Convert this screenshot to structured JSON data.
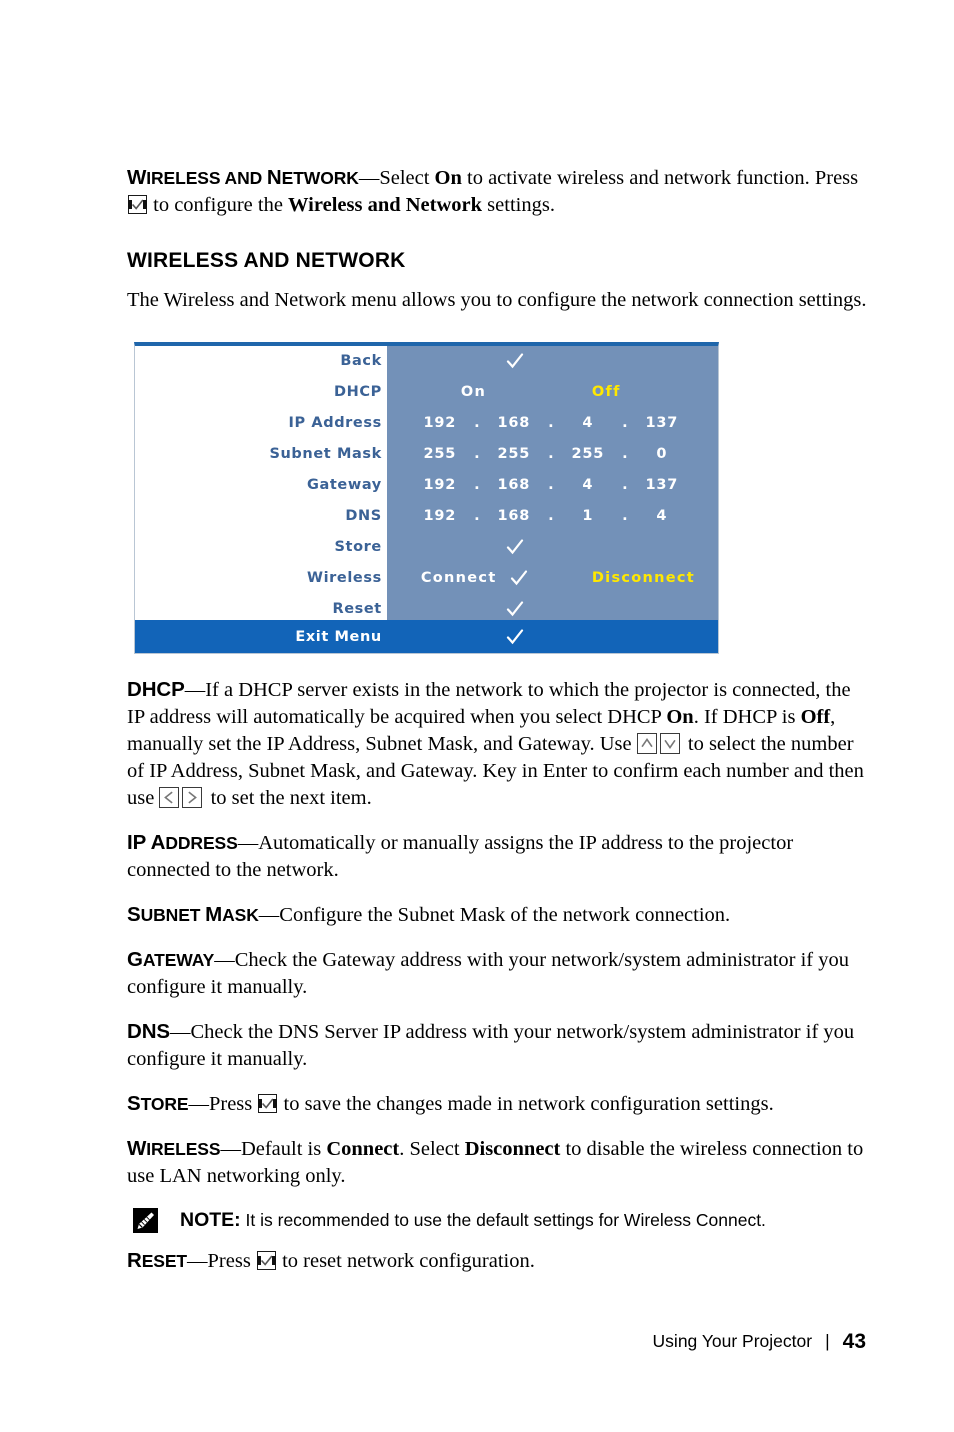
{
  "intro": {
    "term_cap": "W",
    "term_rest": "IRELESS AND ",
    "term_cap2": "N",
    "term_rest2": "ETWORK",
    "text_before_icon": "—Select ",
    "bold_on": "On",
    "text_mid": " to activate wireless and network function. Press ",
    "text_after_icon": " to configure the ",
    "bold_wan": "Wireless and Network",
    "text_end": " settings."
  },
  "section": {
    "heading": "WIRELESS AND NETWORK",
    "description": "The Wireless and Network menu allows you to configure the network connection settings."
  },
  "osd_menu": {
    "rows": [
      {
        "label": "Back",
        "type": "check"
      },
      {
        "label": "DHCP",
        "type": "options",
        "option_a": "On",
        "option_b": "Off",
        "selected": "Off"
      },
      {
        "label": "IP Address",
        "type": "ip",
        "segments": [
          "192",
          "168",
          "4",
          "137"
        ]
      },
      {
        "label": "Subnet Mask",
        "type": "ip",
        "segments": [
          "255",
          "255",
          "255",
          "0"
        ]
      },
      {
        "label": "Gateway",
        "type": "ip",
        "segments": [
          "192",
          "168",
          "4",
          "137"
        ]
      },
      {
        "label": "DNS",
        "type": "ip",
        "segments": [
          "192",
          "168",
          "1",
          "4"
        ]
      },
      {
        "label": "Store",
        "type": "check"
      },
      {
        "label": "Wireless",
        "type": "options_check",
        "option_a": "Connect",
        "option_b": "Disconnect",
        "selected": "Disconnect"
      },
      {
        "label": "Reset",
        "type": "check"
      }
    ],
    "exit": {
      "label": "Exit Menu",
      "type": "check"
    },
    "dot": ".",
    "colors": {
      "label_text": "#3b6296",
      "value_panel": "#7391b8",
      "exit_bar": "#1264b8",
      "highlight": "#ffe800",
      "top_border": "#1f66ab"
    }
  },
  "paragraphs": {
    "dhcp": {
      "term_cap": "DHCP",
      "part1": "—If a DHCP server exists in the network to which the projector is connected, the IP address will automatically be acquired when you select DHCP ",
      "bold_on": "On",
      "part2": ". If DHCP is ",
      "bold_off": "Off",
      "part3": ", manually set the IP Address, Subnet Mask, and Gateway. Use ",
      "part4": " to select the number of IP Address, Subnet Mask, and Gateway. Key in Enter to confirm each number and then use ",
      "part5": " to set the next item."
    },
    "ip_address": {
      "term_cap": "IP A",
      "term_rest": "DDRESS",
      "text": "—Automatically or manually assigns the IP address to the projector connected to the network."
    },
    "subnet_mask": {
      "term_cap": "S",
      "term_rest": "UBNET ",
      "term_cap2": "M",
      "term_rest2": "ASK",
      "text": "—Configure the Subnet Mask of the network connection."
    },
    "gateway": {
      "term_cap": "G",
      "term_rest": "ATEWAY",
      "text": "—Check the Gateway address with your network/system administrator if you configure it manually."
    },
    "dns": {
      "term_cap": "DNS",
      "text": "—Check the DNS Server IP address with your network/system administrator if you configure it manually."
    },
    "store": {
      "term_cap": "S",
      "term_rest": "TORE",
      "text_before": "—Press ",
      "text_after": " to save the changes made in network configuration settings."
    },
    "wireless": {
      "term_cap": "W",
      "term_rest": "IRELESS",
      "part1": "—Default is ",
      "bold_connect": "Connect",
      "part2": ". Select ",
      "bold_disconnect": "Disconnect",
      "part3": " to disable the wireless connection to use LAN networking only."
    },
    "reset": {
      "term_cap": "R",
      "term_rest": "ESET",
      "text_before": "—Press ",
      "text_after": " to reset network configuration."
    }
  },
  "note": {
    "label": "NOTE:",
    "text": " It is recommended to use the default settings for Wireless Connect."
  },
  "footer": {
    "chapter": "Using Your Projector",
    "separator": "|",
    "page_number": "43"
  }
}
